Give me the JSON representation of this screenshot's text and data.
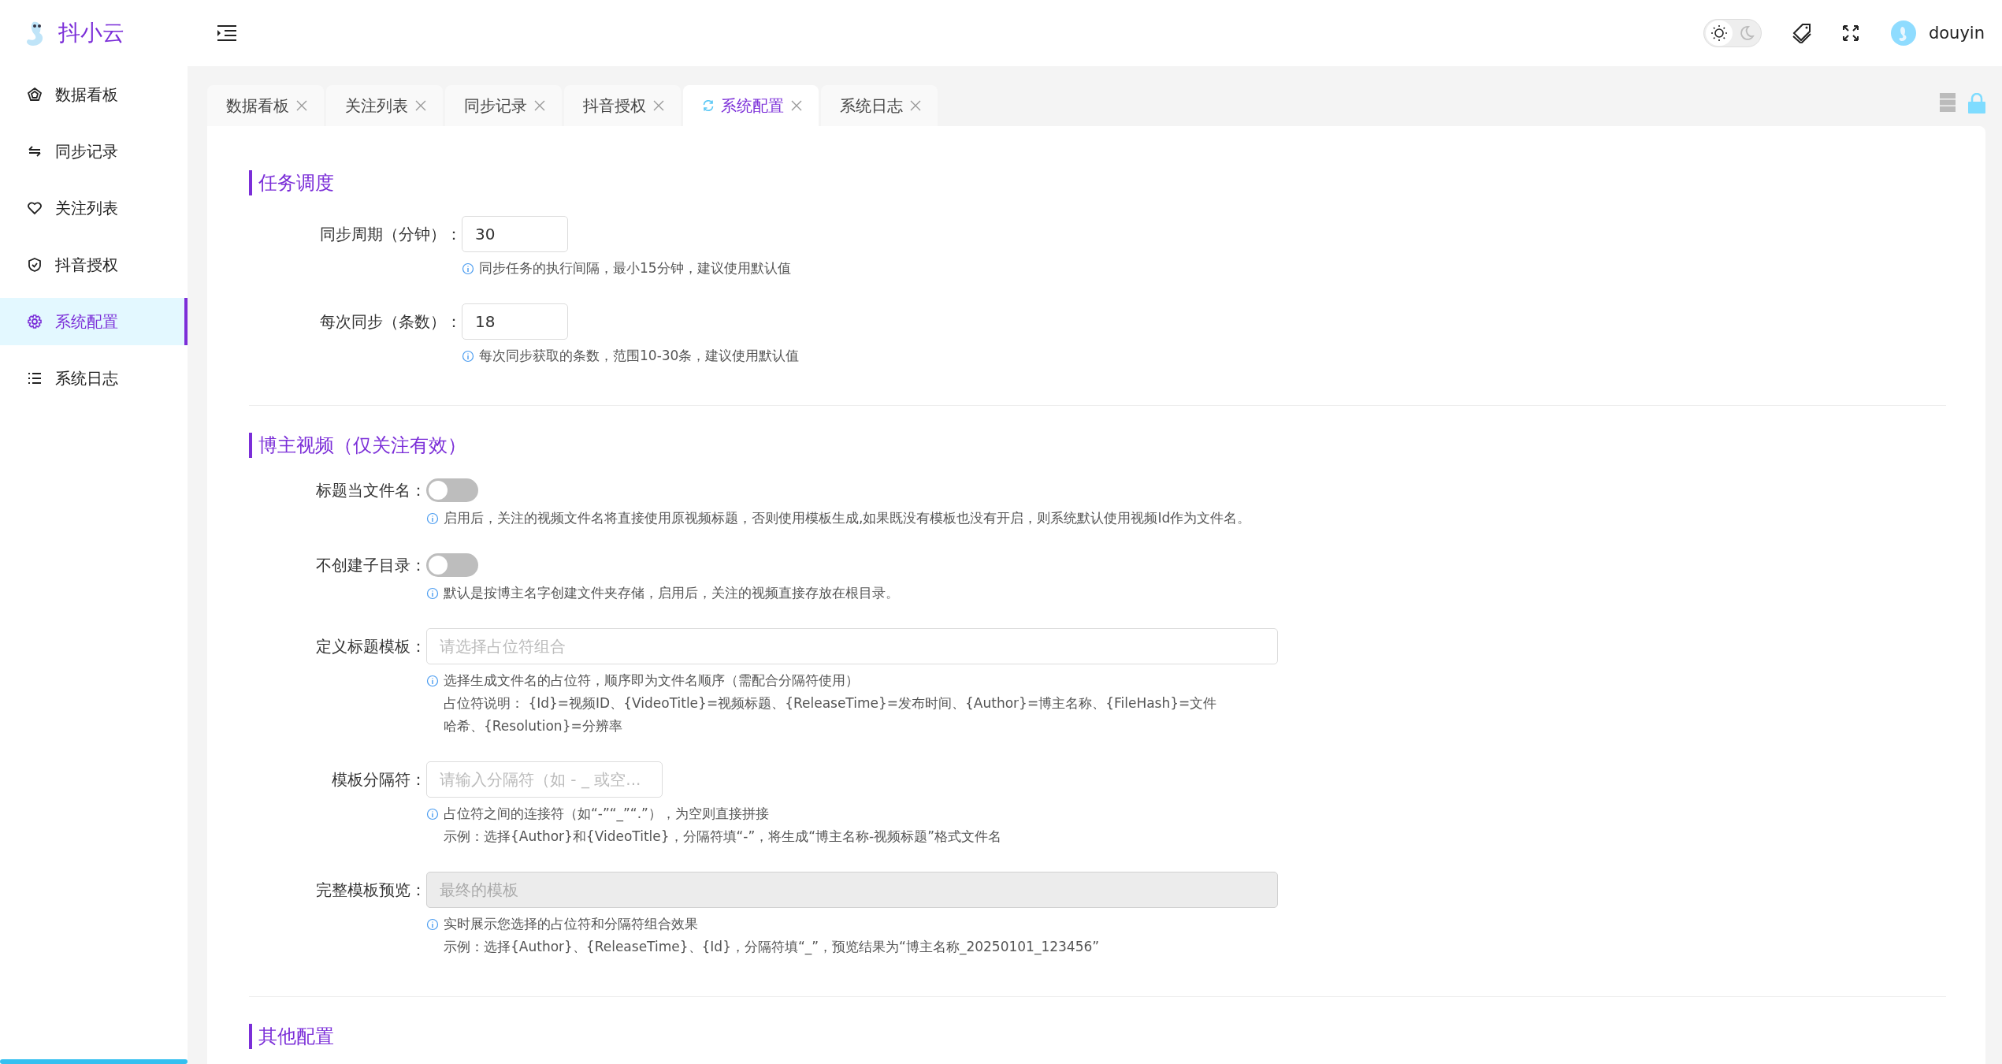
{
  "app": {
    "title": "抖小云"
  },
  "sidebar": {
    "items": [
      {
        "label": "数据看板",
        "selected": false
      },
      {
        "label": "同步记录",
        "selected": false
      },
      {
        "label": "关注列表",
        "selected": false
      },
      {
        "label": "抖音授权",
        "selected": false
      },
      {
        "label": "系统配置",
        "selected": true
      },
      {
        "label": "系统日志",
        "selected": false
      }
    ]
  },
  "header": {
    "theme_toggle": {
      "dark_mode": false
    },
    "user": {
      "name": "douyin"
    }
  },
  "tabs": [
    {
      "label": "数据看板",
      "selected": false
    },
    {
      "label": "关注列表",
      "selected": false
    },
    {
      "label": "同步记录",
      "selected": false
    },
    {
      "label": "抖音授权",
      "selected": false
    },
    {
      "label": "系统配置",
      "selected": true
    },
    {
      "label": "系统日志",
      "selected": false
    }
  ],
  "sections": [
    {
      "title": "任务调度",
      "fields": [
        {
          "kind": "number",
          "label": "同步周期（分钟）：",
          "value": "30",
          "hints": [
            "同步任务的执行间隔，最小15分钟，建议使用默认值"
          ]
        },
        {
          "kind": "number",
          "label": "每次同步（条数）：",
          "value": "18",
          "hints": [
            "每次同步获取的条数，范围10-30条，建议使用默认值"
          ]
        }
      ]
    },
    {
      "title": "博主视频（仅关注有效）",
      "fields": [
        {
          "kind": "switch",
          "label": "标题当文件名：",
          "on": false,
          "hints": [
            "启用后，关注的视频文件名将直接使用原视频标题，否则使用模板生成,如果既没有模板也没有开启，则系统默认使用视频Id作为文件名。"
          ]
        },
        {
          "kind": "switch",
          "label": "不创建子目录：",
          "on": false,
          "hints": [
            "默认是按博主名字创建文件夹存储，启用后，关注的视频直接存放在根目录。"
          ]
        },
        {
          "kind": "select",
          "label": "定义标题模板：",
          "placeholder": "请选择占位符组合",
          "hints": [
            "选择生成文件名的占位符，顺序即为文件名顺序（需配合分隔符使用）",
            "占位符说明： {Id}=视频ID、{VideoTitle}=视频标题、{ReleaseTime}=发布时间、{Author}=博主名称、{FileHash}=文件哈希、{Resolution}=分辨率"
          ]
        },
        {
          "kind": "text",
          "label": "模板分隔符：",
          "placeholder": "请输入分隔符（如 - _ 或空...",
          "hints": [
            "占位符之间的连接符（如“-”“_”“.”），为空则直接拼接",
            "示例：选择{Author}和{VideoTitle}，分隔符填“-”，将生成“博主名称-视频标题”格式文件名"
          ]
        },
        {
          "kind": "wide",
          "label": "完整模板预览：",
          "placeholder": "最终的模板",
          "disabled": true,
          "hints": [
            "实时展示您选择的占位符和分隔符组合效果",
            "示例：选择{Author}、{ReleaseTime}、{Id}，分隔符填“_”，预览结果为“博主名称_20250101_123456”"
          ]
        }
      ]
    },
    {
      "title": "其他配置"
    }
  ]
}
